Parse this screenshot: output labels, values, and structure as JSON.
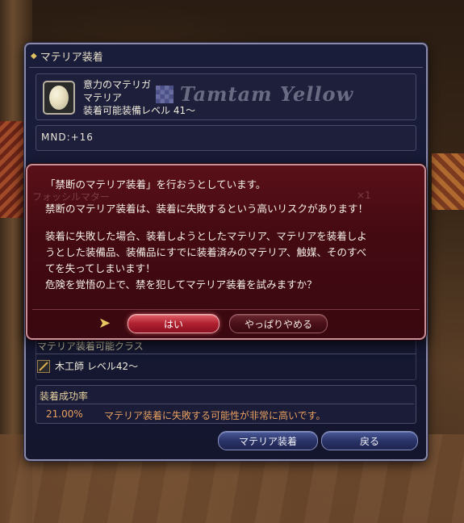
{
  "window": {
    "title": "マテリア装着"
  },
  "item": {
    "name": "意力のマテリガ",
    "type": "マテリア",
    "requirement": "装着可能装備レベル 41～",
    "watermark": "Tamtam Yellow"
  },
  "stat": {
    "text": "MND:+16"
  },
  "dialog": {
    "ghost_label": "フォッシルマター",
    "ghost_count": "×1",
    "line1": "「禁断のマテリア装着」を行おうとしています。",
    "line2": "禁断のマテリア装着は、装着に失敗するという高いリスクがあります！",
    "line3": "装着に失敗した場合、装着しようとしたマテリア、マテリアを装着しよ",
    "line4": "うとした装備品、装備品にすでに装着済みのマテリア、触媒、そのすべ",
    "line5": "てを失ってしまいます！",
    "line6": "危険を覚悟の上で、禁を犯してマテリア装着を試みますか？",
    "yes_label": "はい",
    "no_label": "やっぱりやめる"
  },
  "classes": {
    "header": "マテリア装着可能クラス",
    "entry": "木工師 レベル42～"
  },
  "success": {
    "header": "装着成功率",
    "rate": "21.00%",
    "message": "マテリア装着に失敗する可能性が非常に高いです。"
  },
  "buttons": {
    "attach_label": "マテリア装着",
    "back_label": "戻る"
  },
  "colors": {
    "window_bg": "#1a1d3a",
    "dialog_bg": "#440a12",
    "warning_text": "#e8a060",
    "yes_button": "#b02030"
  }
}
